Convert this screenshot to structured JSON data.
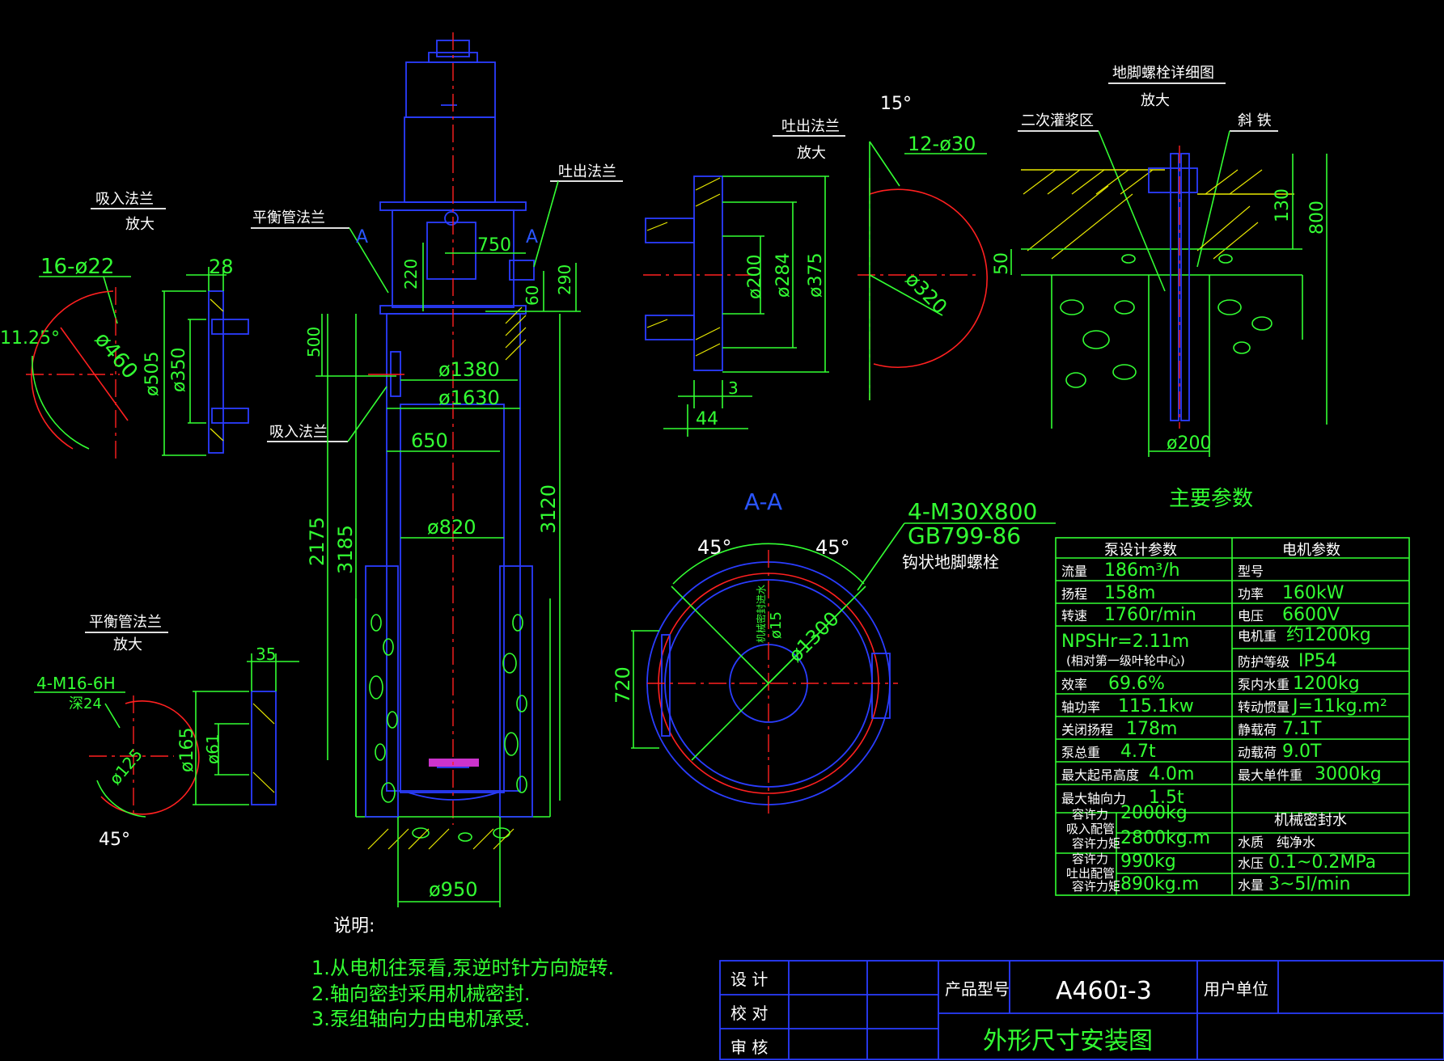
{
  "title_block": {
    "design_label": "设 计",
    "check_label": "校 对",
    "review_label": "审 核",
    "product_model_label": "产品型号",
    "model": "A460ɪ-3",
    "user_unit_label": "用户单位",
    "drawing_title": "外形尺寸安装图"
  },
  "notes": {
    "heading": "说明:",
    "items": [
      "1.从电机往泵看,泵逆时针方向旋转.",
      "2.轴向密封采用机械密封.",
      "3.泵组轴向力由电机承受."
    ]
  },
  "suction_flange": {
    "title": "吸入法兰",
    "scale": "放大",
    "holes": "16-ø22",
    "angle": "11.25°",
    "pcd": "ø460",
    "thickness": "28",
    "od": "ø505",
    "bore": "ø350"
  },
  "balance_flange": {
    "title": "平衡管法兰",
    "scale": "放大",
    "holes": "4-M16-6H",
    "depth": "深24",
    "pcd": "ø125",
    "angle": "45°",
    "thickness": "35",
    "od": "ø165",
    "bore": "ø61"
  },
  "main_view": {
    "balance_label": "平衡管法兰",
    "discharge_label": "吐出法兰",
    "suction_label": "吸入法兰",
    "section_a_left": "A",
    "section_a_right": "A",
    "dims": {
      "d750": "750",
      "d220": "220",
      "d60": "60",
      "d290": "290",
      "d500": "500",
      "d1380": "ø1380",
      "d1630": "ø1630",
      "d650": "650",
      "d820": "ø820",
      "d2175": "2175",
      "d3185": "3185",
      "d3120": "3120",
      "d950": "ø950"
    }
  },
  "discharge_flange": {
    "title": "吐出法兰",
    "scale": "放大",
    "angle": "15°",
    "holes": "12-ø30",
    "d200": "ø200",
    "d284": "ø284",
    "d375": "ø375",
    "d320": "ø320",
    "d3": "3",
    "d44": "44"
  },
  "anchor_bolt": {
    "title": "地脚螺栓详细图",
    "scale": "放大",
    "grout_label": "二次灌浆区",
    "shim_label": "斜 铁",
    "d50": "50",
    "d130": "130",
    "d800": "800",
    "d200": "ø200"
  },
  "section_aa": {
    "title": "A-A",
    "bolt_spec": "4-M30X800",
    "standard": "GB799-86",
    "bolt_name": "钩状地脚螺栓",
    "angle_left": "45°",
    "angle_right": "45°",
    "d720": "720",
    "d1300": "ø1300",
    "d15": "ø15",
    "seal_water": "机械密封进水"
  },
  "params": {
    "title": "主要参数",
    "pump_header": "泵设计参数",
    "motor_header": "电机参数",
    "pump_rows": [
      {
        "label": "流量",
        "value": "186m³/h"
      },
      {
        "label": "扬程",
        "value": "158m"
      },
      {
        "label": "转速",
        "value": "1760r/min"
      },
      {
        "label": "NPSHr=2.11m",
        "value": "(相对第一级叶轮中心)"
      },
      {
        "label": "效率",
        "value": "69.6%"
      },
      {
        "label": "轴功率",
        "value": "115.1kw"
      },
      {
        "label": "关闭扬程",
        "value": "178m"
      },
      {
        "label": "泵总重",
        "value": "4.7t"
      },
      {
        "label": "最大起吊高度",
        "value": "4.0m"
      },
      {
        "label": "最大轴向力",
        "value": "1.5t"
      }
    ],
    "motor_rows": [
      {
        "label": "型号",
        "value": ""
      },
      {
        "label": "功率",
        "value": "160kW"
      },
      {
        "label": "电压",
        "value": "6600V"
      },
      {
        "label": "电机重",
        "value": "约1200kg"
      },
      {
        "label": "防护等级",
        "value": "IP54"
      },
      {
        "label": "泵内水重",
        "value": "1200kg"
      },
      {
        "label": "转动惯量",
        "value": "J=11kg.m²"
      },
      {
        "label": "静载荷",
        "value": "7.1T"
      },
      {
        "label": "动载荷",
        "value": "9.0T"
      },
      {
        "label": "最大单件重",
        "value": "3000kg"
      }
    ],
    "suction_side": {
      "label1": "容许力",
      "label2": "吸入配管",
      "label3": "容许力矩",
      "force": "2000kg",
      "moment": "2800kg.m"
    },
    "discharge_side": {
      "label1": "容许力",
      "label2": "吐出配管",
      "label3": "容许力矩",
      "force": "990kg",
      "moment": "890kg.m"
    },
    "seal_header": "机械密封水",
    "seal_rows": [
      {
        "label": "水质",
        "value": "纯净水"
      },
      {
        "label": "水压",
        "value": "0.1~0.2MPa"
      },
      {
        "label": "水量",
        "value": "3~5l/min"
      }
    ]
  }
}
